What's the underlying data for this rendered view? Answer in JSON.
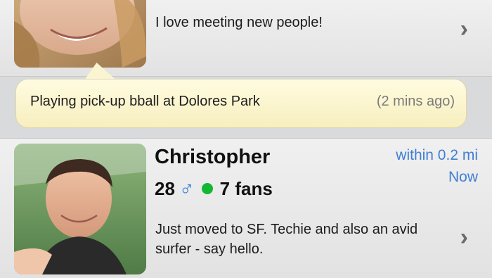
{
  "profiles": [
    {
      "bio": "I love meeting new people!",
      "status": {
        "text": "Playing pick-up bball at Dolores Park",
        "time": "(2 mins ago)"
      }
    },
    {
      "name": "Christopher",
      "age": "28",
      "gender_icon": "male-symbol-icon",
      "gender_symbol": "♂",
      "online_color": "#12b833",
      "fans": "7 fans",
      "distance": "within 0.2 mi",
      "recency": "Now",
      "bio": "Just moved to SF. Techie and also an avid surfer - say hello."
    }
  ],
  "icons": {
    "chevron": "›",
    "row_action": "chevron-right-icon"
  },
  "colors": {
    "status_bubble": "#fbf4d0",
    "link_blue": "#3f7fd4",
    "online_green": "#12b833",
    "male_blue": "#2e7bd6"
  }
}
